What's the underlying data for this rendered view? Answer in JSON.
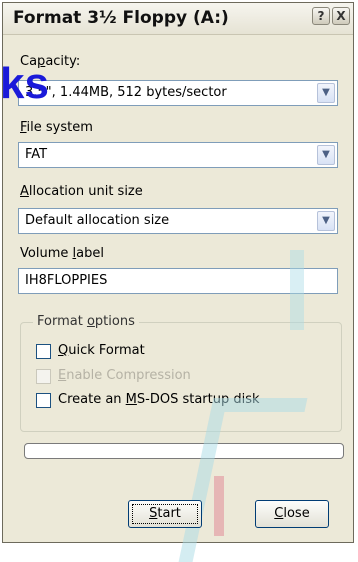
{
  "window": {
    "title": "Format 3½ Floppy (A:)"
  },
  "titlebar_buttons": {
    "help": "?",
    "close": "X"
  },
  "capacity": {
    "label_pre": "Ca",
    "label_u": "p",
    "label_post": "acity:",
    "value": "3.5\", 1.44MB, 512 bytes/sector"
  },
  "filesystem": {
    "label_u": "F",
    "label_post": "ile system",
    "value": "FAT"
  },
  "allocation": {
    "label_u": "A",
    "label_post": "llocation unit size",
    "value": "Default allocation size"
  },
  "volume": {
    "label_pre": "Volume ",
    "label_u": "l",
    "label_post": "abel",
    "value": "IH8FLOPPIES"
  },
  "format_options": {
    "legend_pre": "Format ",
    "legend_u": "o",
    "legend_post": "ptions",
    "quick_u": "Q",
    "quick_post": "uick Format",
    "compress_u": "E",
    "compress_post": "nable Compression",
    "msdos_pre": "Create an ",
    "msdos_u": "M",
    "msdos_post": "S-DOS startup disk"
  },
  "buttons": {
    "start_u": "S",
    "start_post": "tart",
    "close_u": "C",
    "close_post": "lose"
  },
  "overlay_text": "ks"
}
